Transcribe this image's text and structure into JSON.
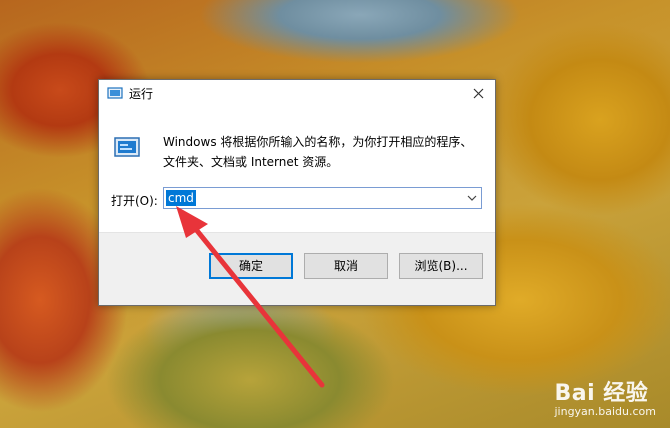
{
  "dialog": {
    "title": "运行",
    "description": "Windows 将根据你所输入的名称，为你打开相应的程序、文件夹、文档或 Internet 资源。",
    "open_label": "打开(O):",
    "input_value": "cmd",
    "buttons": {
      "ok": "确定",
      "cancel": "取消",
      "browse": "浏览(B)..."
    }
  },
  "icons": {
    "title": "run-icon",
    "close": "close-icon",
    "large": "run-large-icon",
    "dropdown": "chevron-down-icon"
  },
  "colors": {
    "accent": "#0078d7",
    "annotation_arrow": "#e8343a"
  },
  "watermark": {
    "logo": "Bai 经验",
    "site": "jingyan.baidu.com"
  }
}
